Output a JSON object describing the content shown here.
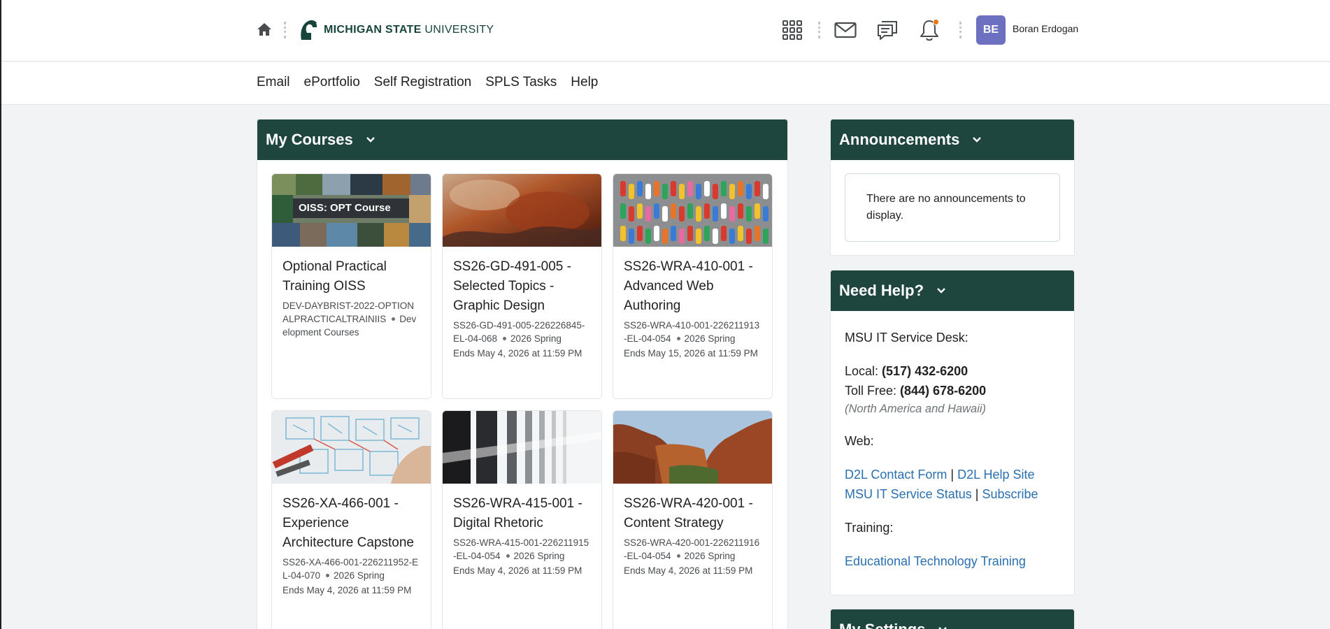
{
  "header": {
    "logo_bold": "MICHIGAN STATE",
    "logo_light": "UNIVERSITY",
    "user_initials": "BE",
    "user_name": "Boran Erdogan",
    "accent": "#18453b",
    "notification_dot_color": "#e87511"
  },
  "nav": {
    "items": [
      "Email",
      "ePortfolio",
      "Self Registration",
      "SPLS Tasks",
      "Help"
    ]
  },
  "my_courses": {
    "title": "My Courses",
    "cards": [
      {
        "image_label": "OISS: OPT Course",
        "title": "Optional Practical Training OISS",
        "code": "DEV-DAYBRIST-2022-OPTIONALPRACTICALTRAINIIS",
        "term": "Development Courses",
        "ends": ""
      },
      {
        "image_label": "",
        "title": "SS26-GD-491-005 - Selected Topics - Graphic Design",
        "code": "SS26-GD-491-005-226226845-EL-04-068",
        "term": "2026 Spring",
        "ends": "Ends May 4, 2026 at 11:59 PM"
      },
      {
        "image_label": "",
        "title": "SS26-WRA-410-001 - Advanced Web Authoring",
        "code": "SS26-WRA-410-001-226211913-EL-04-054",
        "term": "2026 Spring",
        "ends": "Ends May 15, 2026 at 11:59 PM"
      },
      {
        "image_label": "",
        "title": "SS26-XA-466-001 - Experience Architecture Capstone",
        "code": "SS26-XA-466-001-226211952-EL-04-070",
        "term": "2026 Spring",
        "ends": "Ends May 4, 2026 at 11:59 PM"
      },
      {
        "image_label": "",
        "title": "SS26-WRA-415-001 - Digital Rhetoric",
        "code": "SS26-WRA-415-001-226211915-EL-04-054",
        "term": "2026 Spring",
        "ends": "Ends May 4, 2026 at 11:59 PM"
      },
      {
        "image_label": "",
        "title": "SS26-WRA-420-001 - Content Strategy",
        "code": "SS26-WRA-420-001-226211916-EL-04-054",
        "term": "2026 Spring",
        "ends": "Ends May 4, 2026 at 11:59 PM"
      }
    ]
  },
  "announcements": {
    "title": "Announcements",
    "empty_text": "There are no announcements to display."
  },
  "need_help": {
    "title": "Need Help?",
    "service_desk": "MSU IT Service Desk:",
    "local_label": "Local: ",
    "local_phone": "(517) 432-6200",
    "tollfree_label": "Toll Free: ",
    "tollfree_phone": "(844) 678-6200",
    "region_note": "(North America and Hawaii)",
    "web_label": "Web:",
    "link_contact": "D2L Contact Form",
    "link_help_site": "D2L Help Site",
    "link_status": "MSU IT Service Status",
    "link_subscribe": "Subscribe",
    "separator": "|",
    "training_label": "Training:",
    "link_training": "Educational Technology Training"
  },
  "my_settings": {
    "title": "My Settings"
  }
}
